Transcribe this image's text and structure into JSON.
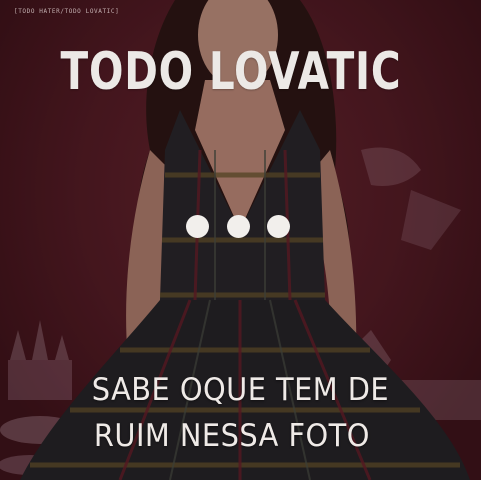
{
  "credit": "[TODO HATER/TODO LOVATIC]",
  "title": "TODO LOVATIC",
  "caption": {
    "line1": "SABE OQUE TEM DE",
    "line2": "RUIM NESSA FOTO"
  },
  "dots_count": 3,
  "colors": {
    "background": "#5a1d27",
    "text": "#ece9e6",
    "dress": "#2a2a2c"
  }
}
